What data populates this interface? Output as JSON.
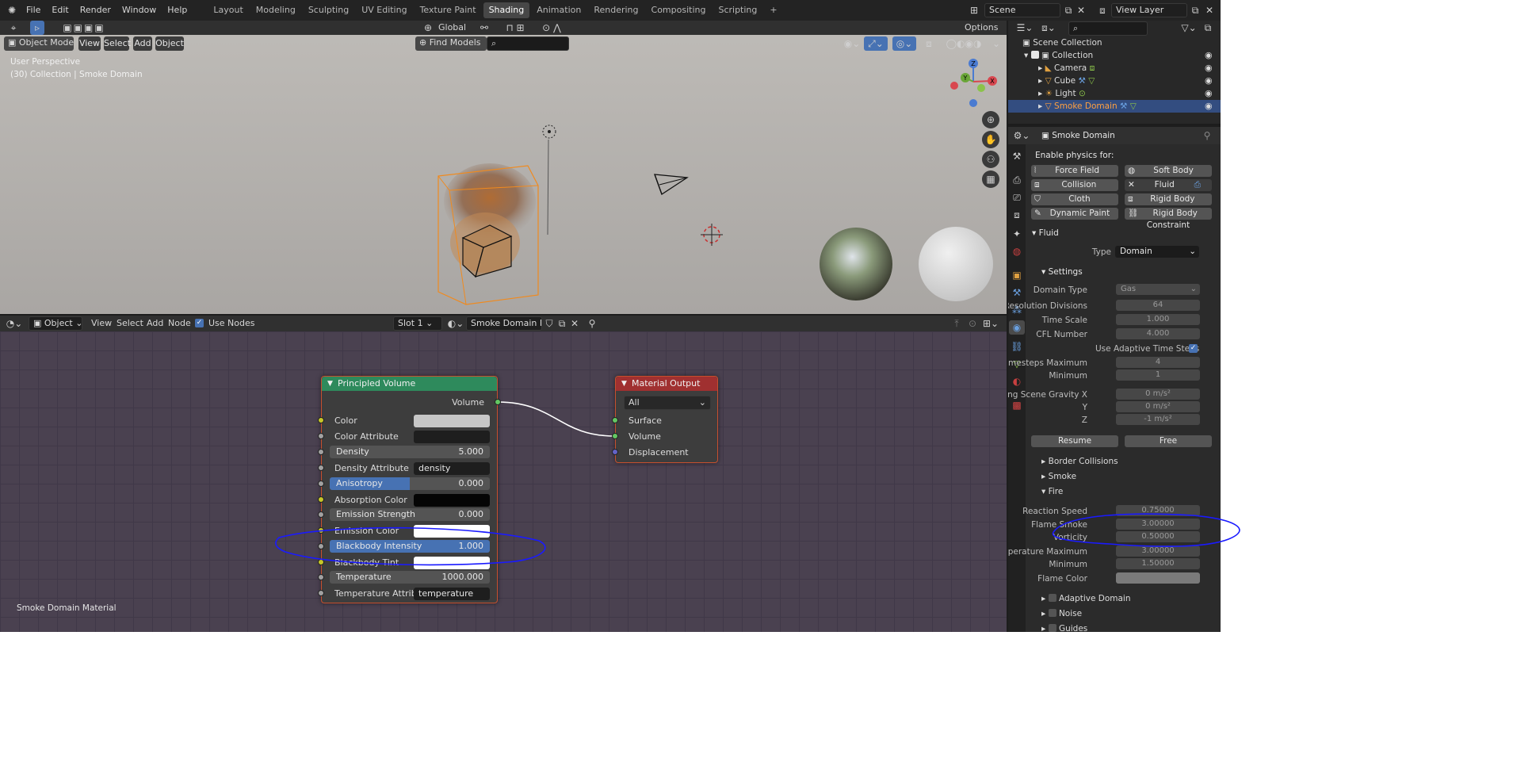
{
  "topbar": {
    "menus": [
      "File",
      "Edit",
      "Render",
      "Window",
      "Help"
    ],
    "workspaces": [
      "Layout",
      "Modeling",
      "Sculpting",
      "UV Editing",
      "Texture Paint",
      "Shading",
      "Animation",
      "Rendering",
      "Compositing",
      "Scripting"
    ],
    "active_workspace": "Shading",
    "add_tab": "+",
    "scene": "Scene",
    "view_layer": "View Layer"
  },
  "viewport": {
    "mode": "Object Mode",
    "menus": [
      "View",
      "Select",
      "Add",
      "Object"
    ],
    "transform": "Global",
    "find_models": "Find Models",
    "options": "Options",
    "overlay_line1": "User Perspective",
    "overlay_line2": "(30) Collection | Smoke Domain",
    "gizmo": {
      "x": "X",
      "y": "Y",
      "z": "Z"
    }
  },
  "node_editor": {
    "type": "Object",
    "menus": [
      "View",
      "Select",
      "Add",
      "Node"
    ],
    "use_nodes": "Use Nodes",
    "slot": "Slot 1",
    "material": "Smoke Domain Mat..",
    "footer_label": "Smoke Domain Material",
    "principled": {
      "title": "Principled Volume",
      "output": "Volume",
      "color": "Color",
      "color_attribute": "Color Attribute",
      "density_label": "Density",
      "density_value": "5.000",
      "density_attribute": "Density Attribute",
      "density_attribute_value": "density",
      "anisotropy_label": "Anisotropy",
      "anisotropy_value": "0.000",
      "absorption_color": "Absorption Color",
      "emission_strength_label": "Emission Strength",
      "emission_strength_value": "0.000",
      "emission_color": "Emission Color",
      "blackbody_label": "Blackbody Intensity",
      "blackbody_value": "1.000",
      "blackbody_tint": "Blackbody Tint",
      "temperature_label": "Temperature",
      "temperature_value": "1000.000",
      "temperature_attribute": "Temperature Attrib..",
      "temperature_attribute_value": "temperature"
    },
    "output": {
      "title": "Material Output",
      "target": "All",
      "surface": "Surface",
      "volume": "Volume",
      "displacement": "Displacement"
    }
  },
  "outliner": {
    "root": "Scene Collection",
    "collection": "Collection",
    "items": [
      "Camera",
      "Cube",
      "Light",
      "Smoke Domain"
    ],
    "selected": "Smoke Domain"
  },
  "properties": {
    "object_name": "Smoke Domain",
    "enable_physics": "Enable physics for:",
    "physics": [
      "Force Field",
      "Soft Body",
      "Collision",
      "Fluid",
      "Cloth",
      "Rigid Body",
      "Dynamic Paint",
      "Rigid Body Constraint"
    ],
    "fluid_panel": "Fluid",
    "type_label": "Type",
    "type_value": "Domain",
    "settings_panel": "Settings",
    "settings": [
      {
        "label": "Domain Type",
        "value": "Gas"
      },
      {
        "label": "Resolution Divisions",
        "value": "64"
      },
      {
        "label": "Time Scale",
        "value": "1.000"
      },
      {
        "label": "CFL Number",
        "value": "4.000"
      }
    ],
    "adaptive_time_steps": "Use Adaptive Time Steps",
    "timesteps": [
      {
        "label": "Timesteps Maximum",
        "value": "4"
      },
      {
        "label": "Minimum",
        "value": "1"
      }
    ],
    "gravity": [
      {
        "label": "Using Scene Gravity X",
        "value": "0 m/s²"
      },
      {
        "label": "Y",
        "value": "0 m/s²"
      },
      {
        "label": "Z",
        "value": "-1 m/s²"
      }
    ],
    "resume": "Resume",
    "free": "Free",
    "border_collisions": "Border Collisions",
    "smoke": "Smoke",
    "fire": "Fire",
    "fire_settings": [
      {
        "label": "Reaction Speed",
        "value": "0.75000"
      },
      {
        "label": "Flame Smoke",
        "value": "3.00000"
      },
      {
        "label": "Vorticity",
        "value": "0.50000"
      },
      {
        "label": "Temperature Maximum",
        "value": "3.00000"
      },
      {
        "label": "Minimum",
        "value": "1.50000"
      }
    ],
    "flame_color": "Flame Color",
    "adaptive_domain": "Adaptive Domain",
    "noise": "Noise",
    "guides": "Guides"
  },
  "colors": {
    "principled_header": "#2e8a5c",
    "output_header": "#a03030",
    "selection_blue": "#4772b3",
    "annotation_blue": "#1a1aff"
  }
}
